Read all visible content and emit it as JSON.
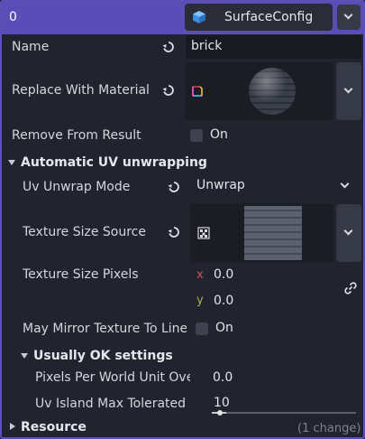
{
  "header": {
    "index": "0",
    "resource_type": "SurfaceConfig"
  },
  "properties": {
    "name": {
      "label": "Name",
      "value": "brick"
    },
    "replace_with_material": {
      "label": "Replace With Material"
    },
    "remove_from_result": {
      "label": "Remove From Result",
      "value": "On"
    }
  },
  "uv_section": {
    "title": "Automatic UV unwrapping",
    "uv_unwrap_mode": {
      "label": "Uv Unwrap Mode",
      "value": "Unwrap"
    },
    "texture_size_source": {
      "label": "Texture Size Source"
    },
    "texture_size_pixels": {
      "label": "Texture Size Pixels",
      "x_label": "x",
      "x_value": "0.0",
      "y_label": "y",
      "y_value": "0.0"
    },
    "may_mirror": {
      "label": "May Mirror Texture To Line",
      "value": "On"
    },
    "usually_ok": {
      "title": "Usually OK settings",
      "pixels_per_world_unit": {
        "label": "Pixels Per World Unit Ove",
        "value": "0.0"
      },
      "uv_island_max": {
        "label": "Uv Island Max Tolerated A",
        "value": "10",
        "slider_fraction": 0.1
      }
    }
  },
  "resource_section": {
    "title": "Resource",
    "note": "(1 change)"
  },
  "colors": {
    "accent": "#5b4db8",
    "axis_x": "#d2554f",
    "axis_y": "#a8b24a"
  },
  "icons": [
    "cube-icon",
    "chevron-down-icon",
    "revert-icon",
    "material-icon",
    "texture-icon",
    "link-icon"
  ]
}
